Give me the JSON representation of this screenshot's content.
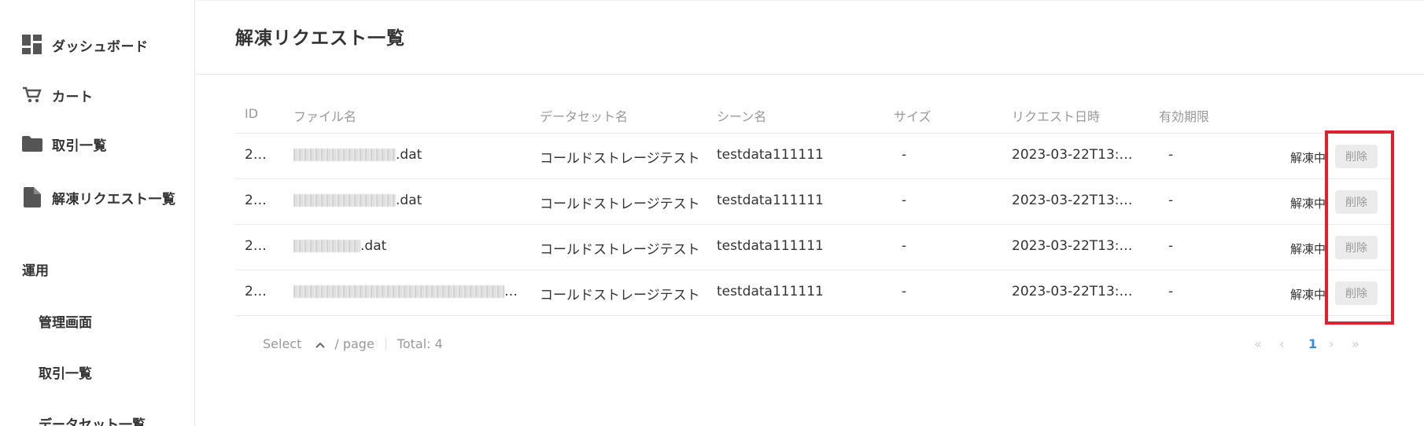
{
  "sidebar": {
    "items": [
      {
        "label": "ダッシュボード",
        "icon": "dashboard-icon"
      },
      {
        "label": "カート",
        "icon": "cart-icon"
      },
      {
        "label": "取引一覧",
        "icon": "folder-icon"
      },
      {
        "label": "解凍リクエスト一覧",
        "icon": "document-icon"
      }
    ],
    "section_title": "運用",
    "sub_items": [
      "管理画面",
      "取引一覧",
      "データセット一覧"
    ]
  },
  "page": {
    "title": "解凍リクエスト一覧"
  },
  "table": {
    "headers": [
      "ID",
      "ファイル名",
      "データセット名",
      "シーン名",
      "サイズ",
      "リクエスト日時",
      "有効期限"
    ],
    "rows": [
      {
        "id": "2…",
        "file_suffix": ".dat",
        "dataset": "コールドストレージテスト",
        "scene": "testdata111111",
        "size": "-",
        "requested_at": "2023-03-22T13:…",
        "expiry": "-",
        "status": "解凍中",
        "action": "削除"
      },
      {
        "id": "2…",
        "file_suffix": ".dat",
        "dataset": "コールドストレージテスト",
        "scene": "testdata111111",
        "size": "-",
        "requested_at": "2023-03-22T13:…",
        "expiry": "-",
        "status": "解凍中",
        "action": "削除"
      },
      {
        "id": "2…",
        "file_suffix": ".dat",
        "dataset": "コールドストレージテスト",
        "scene": "testdata111111",
        "size": "-",
        "requested_at": "2023-03-22T13:…",
        "expiry": "-",
        "status": "解凍中",
        "action": "削除"
      },
      {
        "id": "2…",
        "file_suffix": "…",
        "dataset": "コールドストレージテスト",
        "scene": "testdata111111",
        "size": "-",
        "requested_at": "2023-03-22T13:…",
        "expiry": "-",
        "status": "解凍中",
        "action": "削除"
      }
    ]
  },
  "pagination": {
    "select_label": "Select",
    "per_page": "/ page",
    "total": "Total: 4",
    "current_page": "1"
  },
  "colors": {
    "highlight": "#e0202e",
    "accent": "#2d8cf0"
  }
}
